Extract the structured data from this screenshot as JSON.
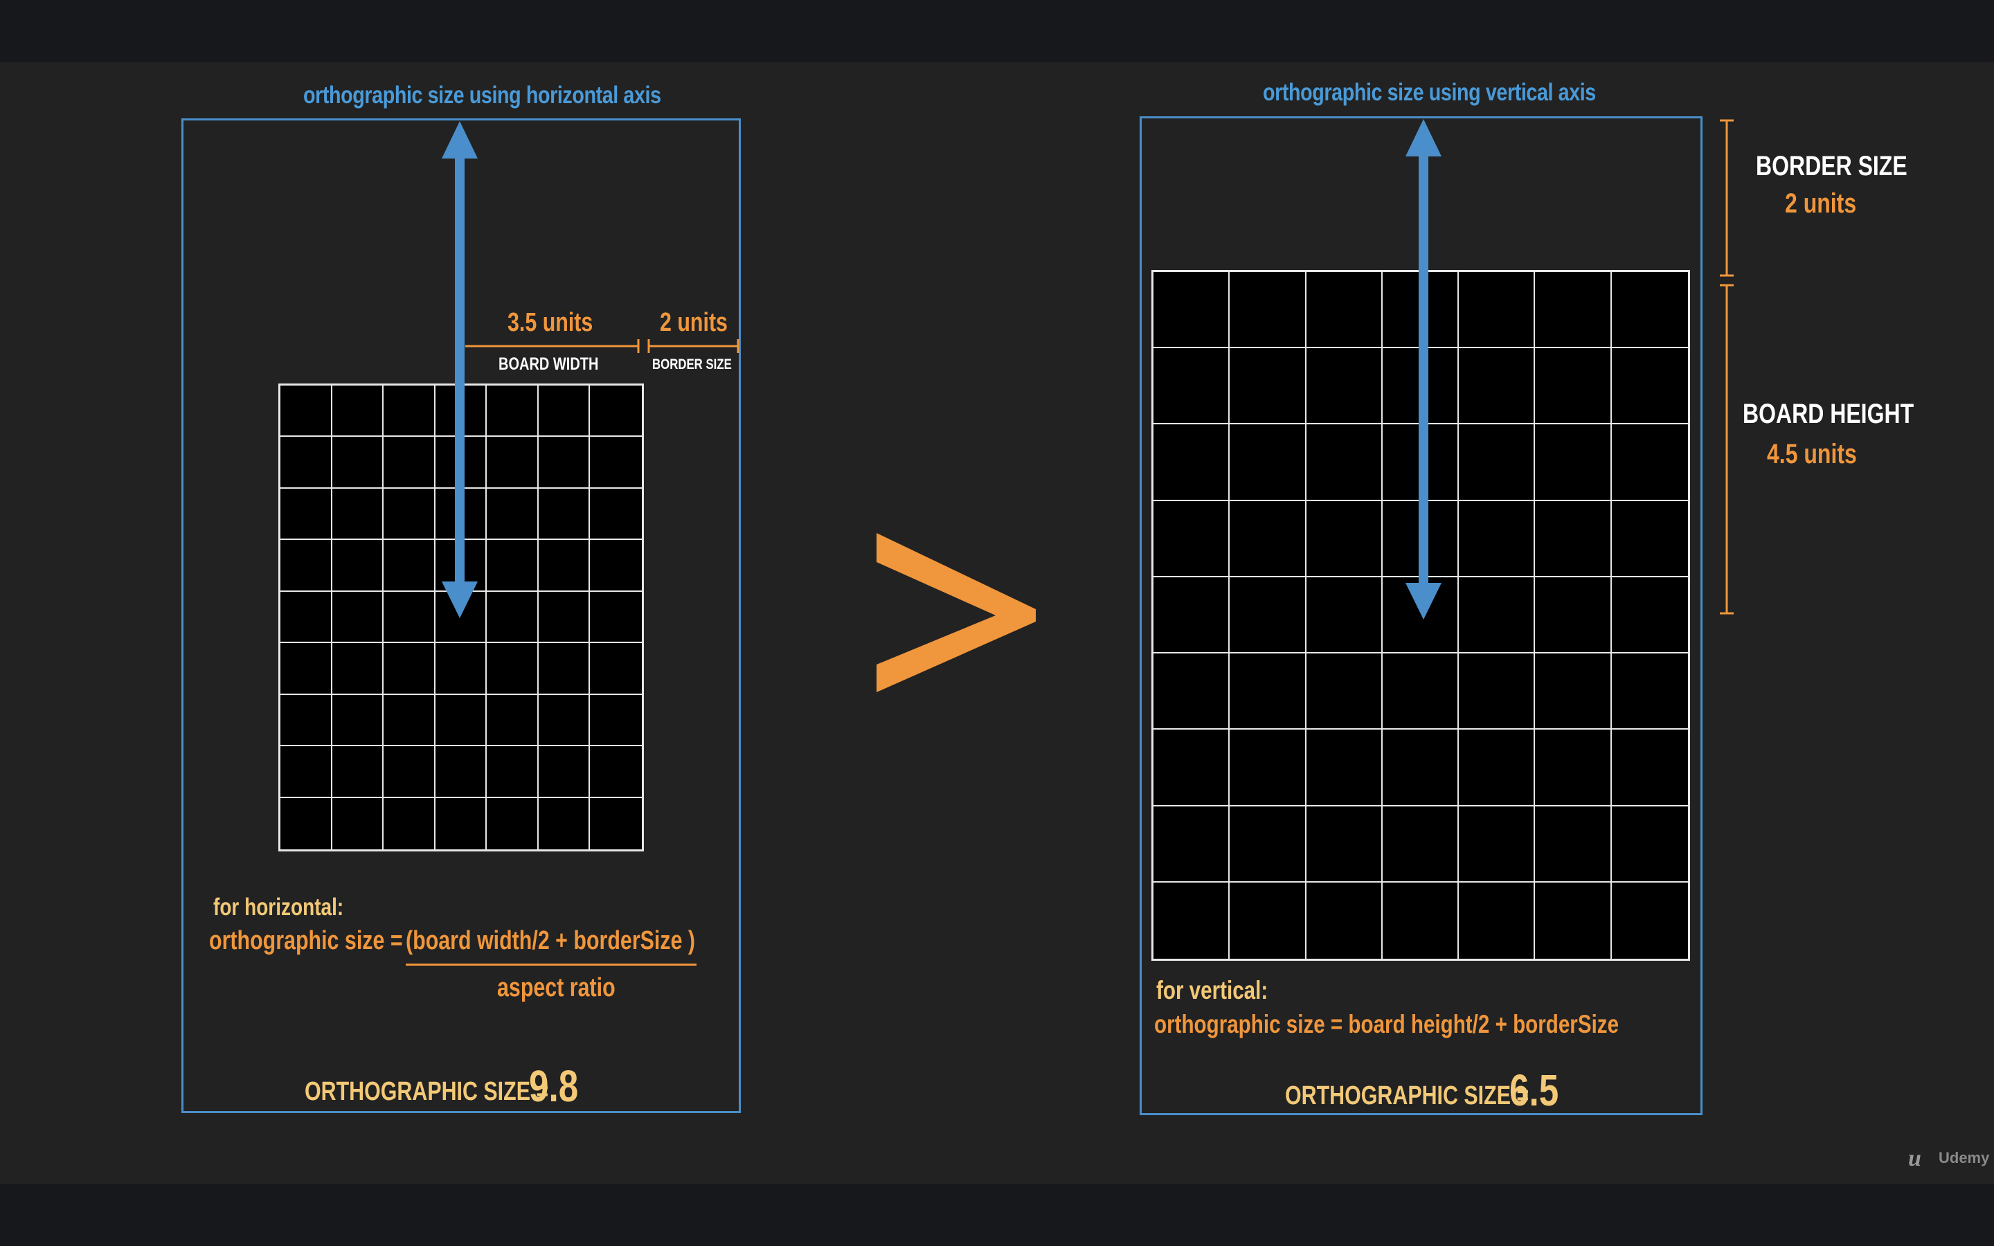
{
  "left": {
    "title": "orthographic size using horizontal axis",
    "board_width_value": "3.5 units",
    "board_width_label": "BOARD WIDTH",
    "border_value": "2 units",
    "border_label": "BORDER SIZE",
    "grid": {
      "columns": 7,
      "rows": 9
    },
    "formula_heading": "for horizontal:",
    "formula_lhs": "orthographic size =",
    "formula_numerator": "(board width/2 + borderSize )",
    "formula_denominator": "aspect ratio",
    "result_label": "ORTHOGRAPHIC SIZE =",
    "result_value": "9.8"
  },
  "comparator": {
    "symbol": ">"
  },
  "right": {
    "title": "orthographic size using vertical axis",
    "border_label": "BORDER SIZE",
    "border_value": "2 units",
    "board_height_label": "BOARD HEIGHT",
    "board_height_value": "4.5 units",
    "grid": {
      "columns": 7,
      "rows": 9
    },
    "formula_heading": "for vertical:",
    "formula": "orthographic size = board height/2  + borderSize",
    "result_label": "ORTHOGRAPHIC SIZE =",
    "result_value": "6.5"
  },
  "branding": {
    "logo_text": "Udemy"
  },
  "colors": {
    "background": "#222222",
    "letterbox": "#17181c",
    "accent_blue": "#4a9ad8",
    "accent_orange": "#f0963c",
    "result_yellow": "#f3c977",
    "grid_line": "#e8e8e8"
  }
}
